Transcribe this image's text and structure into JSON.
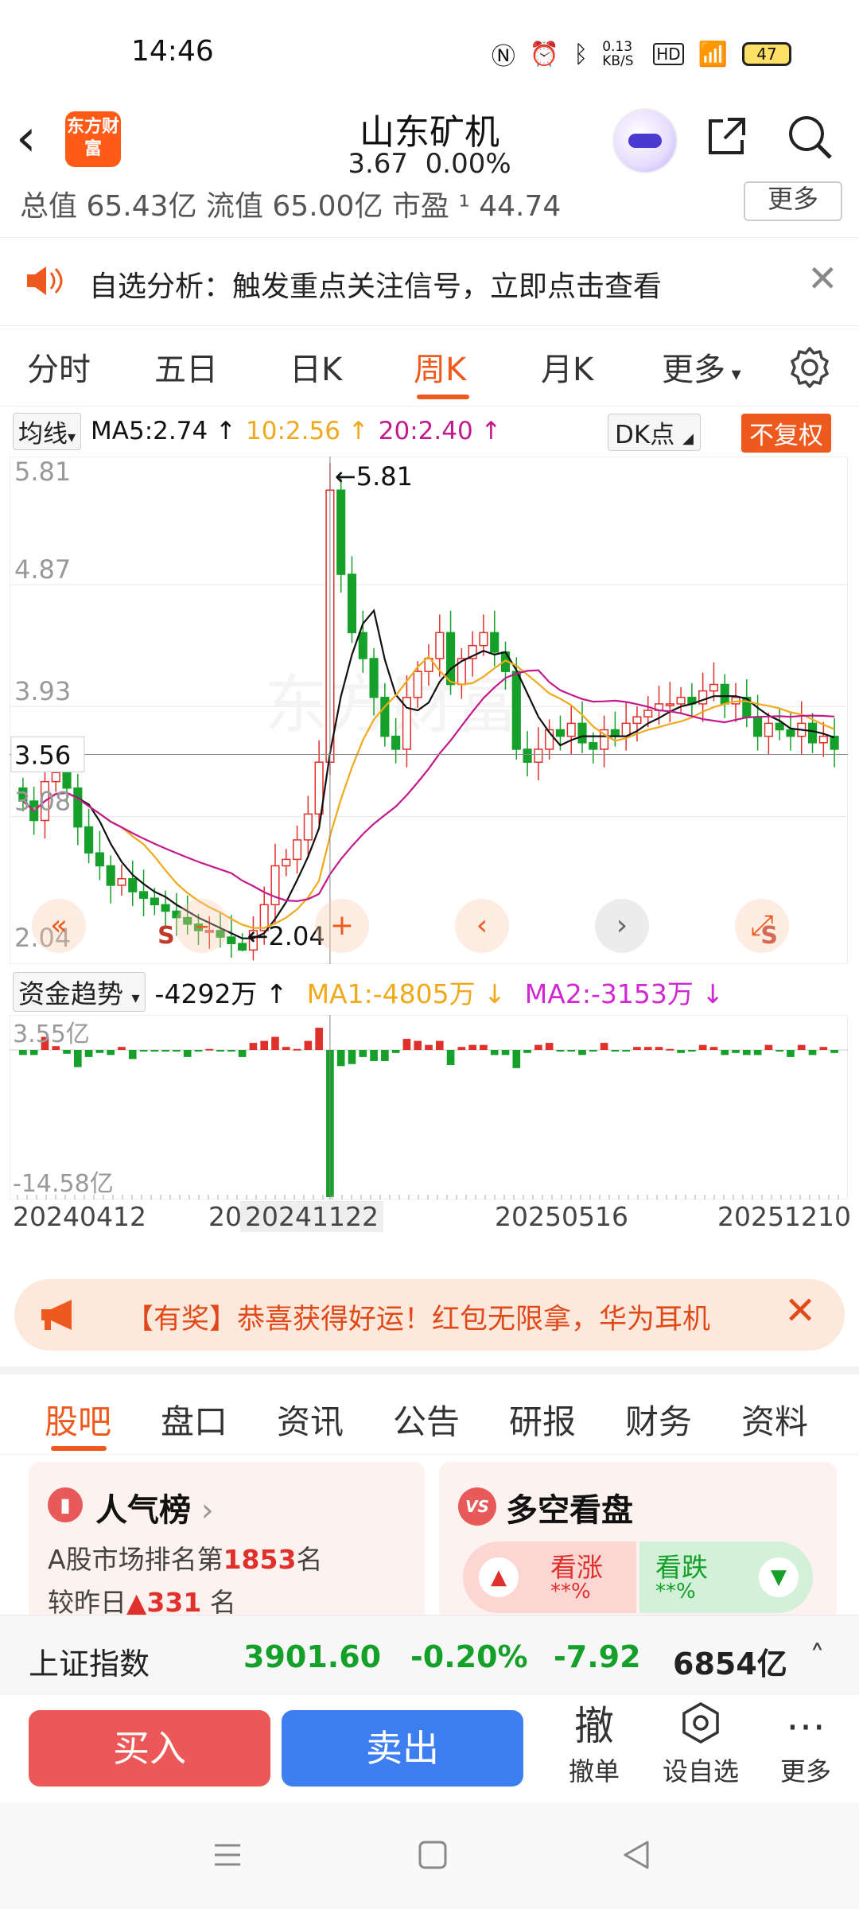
{
  "status": {
    "time": "14:46",
    "net_speed": "0.13 KB/S",
    "battery": "47"
  },
  "header": {
    "logo_text": "东方财富",
    "stock_name": "山东矿机",
    "price": "3.67",
    "change_pct": "0.00%"
  },
  "info_row": {
    "text": "总值 65.43亿  流值 65.00亿  市盈 ¹  44.74",
    "more": "更多"
  },
  "notice": {
    "text": "自选分析：触发重点关注信号，立即点击查看"
  },
  "tabs": [
    "分时",
    "五日",
    "日K",
    "周K",
    "月K",
    "更多"
  ],
  "active_tab": "周K",
  "ma": {
    "pill": "均线",
    "ma5": "MA5:2.74 ↑",
    "ma10": "10:2.56 ↑",
    "ma20": "20:2.40 ↑",
    "dk": "DK点",
    "fq": "不复权"
  },
  "kline": {
    "y_labels": [
      "5.81",
      "4.87",
      "3.93",
      "3.56",
      "3.08",
      "2.04"
    ],
    "max_label": "←5.81",
    "min_label": "←2.04",
    "price_markers": [
      "S",
      "S"
    ]
  },
  "fund": {
    "pill": "资金趋势",
    "value": "-4292万 ↑",
    "ma1": "MA1:-4805万 ↓",
    "ma2": "MA2:-3153万 ↓",
    "top_label": "3.55亿",
    "bottom_label": "-14.58亿"
  },
  "dates": [
    "20240412",
    "20",
    "20241122",
    "20250516",
    "20251210"
  ],
  "prize": {
    "text": "【有奖】恭喜获得好运！红包无限拿，华为耳机"
  },
  "bottom_tabs": [
    "股吧",
    "盘口",
    "资讯",
    "公告",
    "研报",
    "财务",
    "资料"
  ],
  "cards": {
    "hot": {
      "title": "人气榜",
      "rank_prefix": "A股市场排名第",
      "rank": "1853",
      "rank_suffix": "名",
      "prev": "较昨日",
      "prev_num": "331",
      "prev_suffix": "名"
    },
    "vs": {
      "badge": "VS",
      "title": "多空看盘",
      "up": "看涨",
      "up_pct": "**%",
      "down": "看跌",
      "down_pct": "**%"
    }
  },
  "index_bar": {
    "name": "上证指数",
    "value": "3901.60",
    "pct": "-0.20%",
    "chg": "-7.92",
    "amount": "6854亿"
  },
  "actions": {
    "buy": "买入",
    "sell": "卖出",
    "cancel_icon": "撤",
    "cancel": "撤单",
    "watch": "设自选",
    "more": "更多"
  },
  "colors": {
    "up": "#e0302b",
    "down": "#15a02a",
    "accent": "#ee5a1e",
    "ma5": "#111111",
    "ma10": "#f0a91a",
    "ma20": "#c21a8c"
  },
  "chart_data": {
    "type": "candlestick",
    "title": "",
    "xlabel": "",
    "ylabel": "",
    "ylim": [
      2.04,
      5.81
    ],
    "x_range": [
      "20240412",
      "20251210"
    ],
    "max_price": 5.81,
    "min_price": 2.04,
    "current_price": 3.56,
    "y_ticks": [
      5.81,
      4.87,
      3.93,
      3.08,
      2.04
    ],
    "series": [
      {
        "name": "MA5",
        "value": 2.74
      },
      {
        "name": "MA10",
        "value": 2.56
      },
      {
        "name": "MA20",
        "value": 2.4
      }
    ],
    "close": [
      3.2,
      3.05,
      3.35,
      3.42,
      3.3,
      3.0,
      2.8,
      2.7,
      2.55,
      2.6,
      2.5,
      2.45,
      2.4,
      2.35,
      2.3,
      2.25,
      2.2,
      2.2,
      2.15,
      2.1,
      2.05,
      2.2,
      2.4,
      2.7,
      2.75,
      2.9,
      3.1,
      3.5,
      5.6,
      4.95,
      4.5,
      4.3,
      4.0,
      3.7,
      3.6,
      4.0,
      4.2,
      4.3,
      4.5,
      4.1,
      4.3,
      4.4,
      4.5,
      4.35,
      4.2,
      3.6,
      3.5,
      3.6,
      3.75,
      3.7,
      3.8,
      3.65,
      3.6,
      3.75,
      3.7,
      3.8,
      3.85,
      3.9,
      3.95,
      3.95,
      4.0,
      3.95,
      4.05,
      4.1,
      3.95,
      4.0,
      3.85,
      3.7,
      3.8,
      3.75,
      3.7,
      3.8,
      3.65,
      3.7,
      3.6
    ],
    "volume_range": [
      -14.58,
      3.55
    ],
    "volume_unit": "亿"
  }
}
